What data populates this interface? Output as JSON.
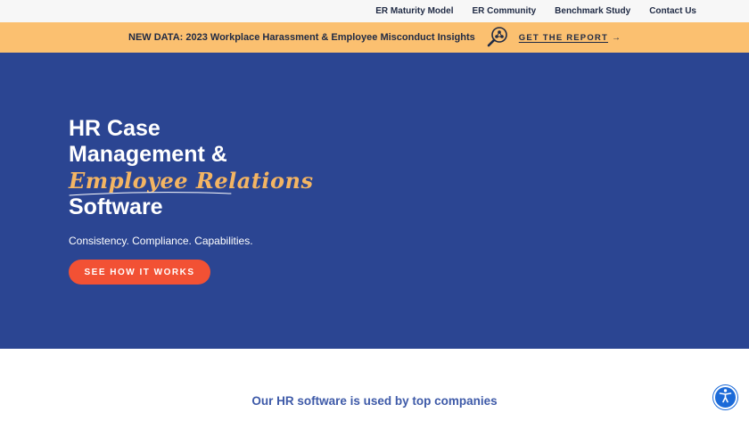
{
  "topnav": {
    "items": [
      {
        "label": "ER Maturity Model"
      },
      {
        "label": "ER Community"
      },
      {
        "label": "Benchmark Study"
      },
      {
        "label": "Contact Us"
      }
    ]
  },
  "banner": {
    "text": "NEW DATA: 2023 Workplace Harassment & Employee Misconduct Insights",
    "icon": "magnifier-network-icon",
    "cta_label": "GET THE REPORT",
    "cta_arrow": "→"
  },
  "hero": {
    "title_line1": "HR Case",
    "title_line2": "Management &",
    "title_script": "Employee Relations",
    "title_line4": "Software",
    "subtitle": "Consistency. Compliance. Capabilities.",
    "button_label": "SEE HOW IT WORKS"
  },
  "clients": {
    "heading": "Our HR software is used by top companies"
  },
  "accessibility": {
    "icon": "accessibility-icon"
  },
  "colors": {
    "hero_bg": "#2b4592",
    "banner_bg": "#fbc070",
    "accent_script": "#f4b563",
    "cta_button": "#f25134",
    "clients_heading": "#3e5aa8",
    "a11y_button": "#1b6ad8"
  }
}
